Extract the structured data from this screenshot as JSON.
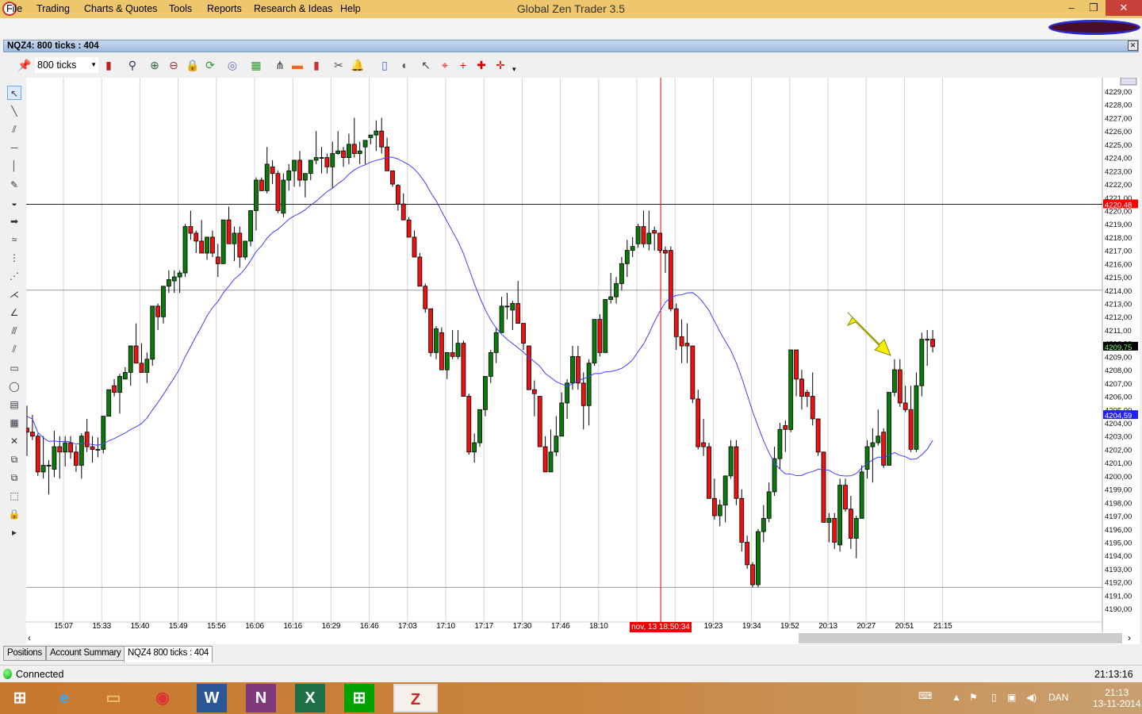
{
  "window": {
    "title": "Global Zen Trader 3.5"
  },
  "menu": [
    "File",
    "Trading",
    "Charts & Quotes",
    "Tools",
    "Reports",
    "Research & Ideas",
    "Help"
  ],
  "chart_window": {
    "caption": "NQZ4: 800 ticks : 404",
    "interval": "800 ticks"
  },
  "toolbar_icons": [
    "pin-icon",
    "candlestick-type-icon",
    "zoom-icon",
    "zoom-in-icon",
    "zoom-out-icon",
    "lock-icon",
    "refresh-icon",
    "indicator-icon",
    "chart-template-icon",
    "hierarchy-icon",
    "color-bar-icon",
    "bar-chart-icon",
    "scissors-icon",
    "bell-icon",
    "phone-icon",
    "mouse-icon",
    "cursor-icon",
    "crosshair-cursor-icon",
    "crosshair-icon",
    "crosshair-dot-icon",
    "crosshair-line-icon"
  ],
  "left_tools": [
    "select-arrow-icon",
    "line-icon",
    "parallel-lines-icon",
    "horizontal-line-icon",
    "vertical-line-icon",
    "note-icon",
    "ellipse-tool-icon",
    "arrow-tool-icon",
    "wave-icon",
    "fibonacci-icon",
    "fib-extension-icon",
    "pitchfork-icon",
    "gann-icon",
    "fan-icon",
    "channel-icon",
    "rectangle-icon",
    "circle-icon",
    "template-icon",
    "properties-icon",
    "delete-icon",
    "copy-icon",
    "layers-icon",
    "region-icon",
    "lock-icon",
    "expand-icon"
  ],
  "chart_data": {
    "type": "candlestick",
    "symbol": "NQZ4",
    "ylim": [
      4189.5,
      4230
    ],
    "y_ticks_from": 4190,
    "y_ticks_to": 4229,
    "y_tick_step": 1,
    "x_labels": [
      "15:07",
      "15:33",
      "15:40",
      "15:49",
      "15:56",
      "16:06",
      "16:16",
      "16:29",
      "16:46",
      "17:03",
      "17:10",
      "17:17",
      "17:30",
      "17:46",
      "18:10",
      "",
      "",
      "19:23",
      "19:34",
      "19:52",
      "20:13",
      "20:27",
      "20:51",
      "21:15"
    ],
    "crosshair_time": "nov, 13 18:50:34",
    "crosshair_bar": 117,
    "price_labels": {
      "horizontal_line": "4220,48",
      "last_price": "4209,75",
      "moving_average": "4204,59"
    },
    "horizontal_lines": [
      4220.48,
      4214.0,
      4191.6
    ],
    "ma_period": 20,
    "candles_ohlc": [
      [
        4203.6,
        4205.3,
        4201.5,
        4203.3
      ],
      [
        4203.3,
        4204.6,
        4202.7,
        4203.0
      ],
      [
        4203.0,
        4203.2,
        4200.0,
        4200.3
      ],
      [
        4200.3,
        4203.0,
        4199.8,
        4200.8
      ],
      [
        4200.8,
        4201.2,
        4198.6,
        4200.8
      ],
      [
        4200.5,
        4203.4,
        4199.9,
        4202.2
      ],
      [
        4202.2,
        4203.0,
        4199.8,
        4201.8
      ],
      [
        4201.8,
        4203.0,
        4200.7,
        4202.5
      ],
      [
        4202.5,
        4203.0,
        4201.3,
        4201.8
      ],
      [
        4201.8,
        4202.3,
        4200.3,
        4200.8
      ],
      [
        4200.8,
        4203.2,
        4199.8,
        4203.0
      ],
      [
        4203.3,
        4204.3,
        4201.8,
        4202.2
      ],
      [
        4202.2,
        4203.0,
        4201.0,
        4202.0
      ],
      [
        4202.0,
        4202.9,
        4201.4,
        4202.0
      ],
      [
        4202.0,
        4204.5,
        4201.7,
        4204.5
      ],
      [
        4204.5,
        4206.5,
        4204.5,
        4206.5
      ],
      [
        4206.8,
        4207.3,
        4206.0,
        4206.3
      ],
      [
        4206.3,
        4207.7,
        4204.7,
        4207.5
      ],
      [
        4207.3,
        4208.2,
        4207.3,
        4207.8
      ],
      [
        4207.8,
        4209.8,
        4206.8,
        4209.8
      ],
      [
        4209.8,
        4211.5,
        4208.5,
        4208.5
      ],
      [
        4208.5,
        4210.0,
        4207.8,
        4207.8
      ],
      [
        4207.8,
        4209.3,
        4207.0,
        4208.8
      ],
      [
        4208.8,
        4212.8,
        4208.3,
        4212.8
      ],
      [
        4212.8,
        4213.0,
        4211.0,
        4212.0
      ],
      [
        4212.0,
        4214.3,
        4211.5,
        4214.3
      ],
      [
        4214.3,
        4215.5,
        4213.8,
        4214.8
      ],
      [
        4214.7,
        4215.5,
        4213.8,
        4215.0
      ],
      [
        4215.0,
        4215.5,
        4213.8,
        4215.3
      ],
      [
        4215.3,
        4219.0,
        4215.0,
        4218.8
      ],
      [
        4218.8,
        4220.0,
        4217.8,
        4218.3
      ],
      [
        4218.3,
        4218.5,
        4216.8,
        4217.7
      ],
      [
        4217.7,
        4219.3,
        4216.8,
        4216.8
      ],
      [
        4216.8,
        4218.0,
        4216.3,
        4218.0
      ],
      [
        4218.0,
        4218.5,
        4216.5,
        4216.8
      ],
      [
        4216.5,
        4217.5,
        4215.0,
        4216.0
      ],
      [
        4216.0,
        4219.3,
        4216.0,
        4219.3
      ],
      [
        4219.3,
        4220.3,
        4217.5,
        4217.5
      ],
      [
        4217.5,
        4218.8,
        4216.2,
        4218.3
      ],
      [
        4218.3,
        4218.8,
        4215.7,
        4216.5
      ],
      [
        4216.5,
        4217.7,
        4216.3,
        4217.7
      ],
      [
        4217.7,
        4220.0,
        4217.3,
        4220.0
      ],
      [
        4220.0,
        4222.5,
        4218.5,
        4222.3
      ],
      [
        4222.3,
        4222.5,
        4221.5,
        4221.5
      ],
      [
        4221.5,
        4224.8,
        4221.3,
        4223.5
      ],
      [
        4223.3,
        4223.8,
        4222.0,
        4222.8
      ],
      [
        4222.8,
        4223.0,
        4219.8,
        4220.0
      ],
      [
        4219.8,
        4222.8,
        4219.5,
        4222.3
      ],
      [
        4222.3,
        4223.5,
        4221.5,
        4223.0
      ],
      [
        4223.0,
        4223.8,
        4221.8,
        4223.8
      ],
      [
        4223.8,
        4224.5,
        4221.8,
        4222.3
      ],
      [
        4222.3,
        4222.8,
        4221.0,
        4222.8
      ],
      [
        4222.8,
        4223.8,
        4222.3,
        4223.8
      ],
      [
        4223.8,
        4226.0,
        4223.5,
        4224.0
      ],
      [
        4224.0,
        4224.8,
        4222.8,
        4224.0
      ],
      [
        4224.0,
        4224.3,
        4222.8,
        4223.3
      ],
      [
        4223.3,
        4225.2,
        4221.7,
        4224.3
      ],
      [
        4224.3,
        4226.0,
        4224.2,
        4224.5
      ],
      [
        4224.5,
        4224.8,
        4223.3,
        4224.0
      ],
      [
        4224.0,
        4225.8,
        4223.5,
        4225.0
      ],
      [
        4225.0,
        4227.0,
        4224.0,
        4224.3
      ],
      [
        4224.3,
        4225.2,
        4223.5,
        4224.5
      ],
      [
        4224.8,
        4225.3,
        4223.5,
        4225.3
      ],
      [
        4225.5,
        4225.7,
        4225.0,
        4225.7
      ],
      [
        4225.7,
        4226.8,
        4224.5,
        4226.0
      ],
      [
        4226.0,
        4227.0,
        4224.3,
        4224.8
      ],
      [
        4224.8,
        4225.5,
        4223.0,
        4223.0
      ],
      [
        4223.0,
        4223.0,
        4221.8,
        4222.0
      ],
      [
        4221.9,
        4222.0,
        4220.0,
        4220.5
      ],
      [
        4220.5,
        4221.3,
        4219.3,
        4219.3
      ],
      [
        4219.3,
        4219.5,
        4218.0,
        4218.0
      ],
      [
        4218.0,
        4218.5,
        4216.5,
        4216.5
      ],
      [
        4216.5,
        4216.8,
        4214.3,
        4214.3
      ],
      [
        4214.3,
        4214.5,
        4212.3,
        4212.6
      ],
      [
        4212.6,
        4212.6,
        4209.0,
        4209.3
      ],
      [
        4209.3,
        4211.3,
        4208.8,
        4211.1
      ],
      [
        4210.8,
        4211.2,
        4208.0,
        4208.0
      ],
      [
        4208.0,
        4209.3,
        4207.3,
        4209.3
      ],
      [
        4209.3,
        4211.0,
        4208.8,
        4209.0
      ],
      [
        4209.0,
        4211.0,
        4208.8,
        4210.0
      ],
      [
        4210.0,
        4210.2,
        4206.0,
        4206.0
      ],
      [
        4206.0,
        4206.2,
        4201.6,
        4201.8
      ],
      [
        4201.8,
        4203.2,
        4201.0,
        4202.5
      ],
      [
        4202.5,
        4205.0,
        4202.2,
        4205.0
      ],
      [
        4205.0,
        4207.5,
        4204.5,
        4207.5
      ],
      [
        4207.5,
        4209.5,
        4207.0,
        4209.3
      ],
      [
        4209.3,
        4211.2,
        4208.5,
        4210.8
      ],
      [
        4210.8,
        4213.5,
        4210.8,
        4212.8
      ],
      [
        4212.8,
        4213.8,
        4211.8,
        4212.8
      ],
      [
        4212.5,
        4213.2,
        4211.0,
        4213.0
      ],
      [
        4213.0,
        4214.7,
        4211.5,
        4211.5
      ],
      [
        4211.5,
        4211.5,
        4209.5,
        4210.0
      ],
      [
        4209.8,
        4209.8,
        4206.5,
        4206.5
      ],
      [
        4206.5,
        4207.2,
        4204.5,
        4206.2
      ],
      [
        4206.0,
        4206.0,
        4202.2,
        4202.2
      ],
      [
        4202.2,
        4203.0,
        4200.3,
        4200.3
      ],
      [
        4200.3,
        4203.5,
        4200.3,
        4201.8
      ],
      [
        4201.8,
        4204.5,
        4201.5,
        4203.0
      ],
      [
        4203.0,
        4206.3,
        4203.0,
        4205.5
      ],
      [
        4205.5,
        4207.3,
        4204.3,
        4207.0
      ],
      [
        4207.0,
        4209.8,
        4206.5,
        4209.0
      ],
      [
        4209.0,
        4209.8,
        4206.5,
        4207.0
      ],
      [
        4207.0,
        4207.8,
        4203.5,
        4205.3
      ],
      [
        4205.3,
        4208.8,
        4203.8,
        4208.5
      ],
      [
        4208.5,
        4211.8,
        4208.3,
        4211.8
      ],
      [
        4211.8,
        4212.2,
        4209.0,
        4209.3
      ],
      [
        4209.3,
        4213.3,
        4209.3,
        4213.3
      ],
      [
        4213.3,
        4215.3,
        4213.0,
        4213.5
      ],
      [
        4213.5,
        4215.0,
        4213.0,
        4214.5
      ],
      [
        4214.5,
        4216.5,
        4214.0,
        4216.0
      ],
      [
        4216.0,
        4217.8,
        4215.0,
        4217.0
      ],
      [
        4217.0,
        4218.0,
        4216.5,
        4217.3
      ],
      [
        4217.5,
        4219.0,
        4217.2,
        4218.8
      ],
      [
        4218.8,
        4220.0,
        4217.2,
        4217.5
      ],
      [
        4217.5,
        4220.0,
        4217.0,
        4218.3
      ],
      [
        4218.5,
        4218.8,
        4217.0,
        4218.3
      ],
      [
        4218.3,
        4218.3,
        4216.8,
        4217.0
      ],
      [
        4217.0,
        4217.3,
        4215.3,
        4216.8
      ],
      [
        4217.0,
        4217.3,
        4212.4,
        4212.6
      ],
      [
        4212.6,
        4213.0,
        4209.5,
        4210.5
      ],
      [
        4210.5,
        4211.8,
        4208.5,
        4209.8
      ],
      [
        4210.0,
        4211.5,
        4208.5,
        4209.8
      ],
      [
        4209.8,
        4209.8,
        4205.5,
        4205.8
      ],
      [
        4205.8,
        4206.5,
        4202.0,
        4202.2
      ],
      [
        4202.5,
        4204.3,
        4201.5,
        4202.2
      ],
      [
        4202.2,
        4202.5,
        4198.3,
        4198.3
      ],
      [
        4198.3,
        4199.8,
        4196.7,
        4197.0
      ],
      [
        4197.0,
        4198.2,
        4196.2,
        4197.8
      ],
      [
        4197.8,
        4200.0,
        4196.5,
        4200.0
      ],
      [
        4200.0,
        4202.7,
        4199.8,
        4202.2
      ],
      [
        4202.2,
        4202.7,
        4197.8,
        4198.3
      ],
      [
        4198.3,
        4199.0,
        4194.3,
        4195.0
      ],
      [
        4195.0,
        4195.5,
        4193.0,
        4193.3
      ],
      [
        4193.3,
        4193.5,
        4191.6,
        4191.8
      ],
      [
        4191.8,
        4196.0,
        4191.6,
        4195.8
      ],
      [
        4195.8,
        4197.8,
        4195.0,
        4196.8
      ],
      [
        4196.8,
        4199.5,
        4196.5,
        4198.8
      ],
      [
        4198.8,
        4202.2,
        4198.5,
        4201.3
      ],
      [
        4201.3,
        4204.0,
        4200.5,
        4203.5
      ],
      [
        4203.8,
        4204.2,
        4201.8,
        4203.5
      ],
      [
        4203.5,
        4209.5,
        4203.3,
        4209.5
      ],
      [
        4209.5,
        4209.5,
        4206.0,
        4207.3
      ],
      [
        4207.3,
        4208.0,
        4205.0,
        4206.0
      ],
      [
        4206.3,
        4206.5,
        4205.2,
        4206.0
      ],
      [
        4206.0,
        4207.8,
        4203.8,
        4204.3
      ],
      [
        4204.3,
        4204.3,
        4201.5,
        4201.8
      ],
      [
        4201.8,
        4201.8,
        4196.5,
        4196.5
      ],
      [
        4196.5,
        4197.2,
        4195.0,
        4196.8
      ],
      [
        4196.8,
        4197.2,
        4194.5,
        4195.0
      ],
      [
        4194.8,
        4199.8,
        4194.3,
        4199.3
      ],
      [
        4199.3,
        4199.8,
        4197.3,
        4197.5
      ],
      [
        4197.5,
        4198.5,
        4194.5,
        4195.3
      ],
      [
        4195.3,
        4197.0,
        4193.8,
        4196.8
      ],
      [
        4196.8,
        4200.8,
        4196.8,
        4200.3
      ],
      [
        4200.5,
        4202.7,
        4199.8,
        4202.2
      ],
      [
        4202.2,
        4203.6,
        4199.5,
        4202.5
      ],
      [
        4202.5,
        4205.0,
        4202.3,
        4203.0
      ],
      [
        4203.3,
        4203.6,
        4200.6,
        4200.8
      ],
      [
        4200.8,
        4206.3,
        4200.8,
        4206.3
      ],
      [
        4206.3,
        4208.8,
        4206.0,
        4208.0
      ],
      [
        4208.0,
        4208.8,
        4205.2,
        4205.5
      ],
      [
        4205.5,
        4206.8,
        4204.8,
        4205.0
      ],
      [
        4205.0,
        4206.8,
        4201.8,
        4202.0
      ],
      [
        4202.0,
        4207.8,
        4201.8,
        4206.8
      ],
      [
        4206.8,
        4210.8,
        4206.0,
        4210.3
      ],
      [
        4210.3,
        4211.0,
        4208.3,
        4210.3
      ],
      [
        4210.3,
        4211.0,
        4209.3,
        4209.75
      ]
    ],
    "colors": {
      "up": "#0a7a0a",
      "down": "#ee1111",
      "ma": "#4040ff",
      "hline_label": "#ff0000",
      "last_label": "#000000",
      "ma_label": "#2020ff"
    },
    "annotation": "yellow-arrow"
  },
  "bottom_tabs": [
    "Positions",
    "Account Summary",
    "NQZ4 800 ticks : 404"
  ],
  "status": {
    "connection": "Connected",
    "time": "21:13:16"
  },
  "taskbar": {
    "apps": [
      {
        "name": "windows-start-icon",
        "glyph": "⊞"
      },
      {
        "name": "internet-explorer-icon",
        "glyph": "e"
      },
      {
        "name": "file-explorer-icon",
        "glyph": "▭"
      },
      {
        "name": "chrome-icon",
        "glyph": "◉"
      },
      {
        "name": "word-icon",
        "glyph": "W"
      },
      {
        "name": "onenote-icon",
        "glyph": "N"
      },
      {
        "name": "excel-icon",
        "glyph": "X"
      },
      {
        "name": "store-icon",
        "glyph": "⊞"
      },
      {
        "name": "global-zen-icon",
        "glyph": "Z"
      }
    ],
    "language": "DAN",
    "time": "21:13",
    "date": "13-11-2014"
  }
}
